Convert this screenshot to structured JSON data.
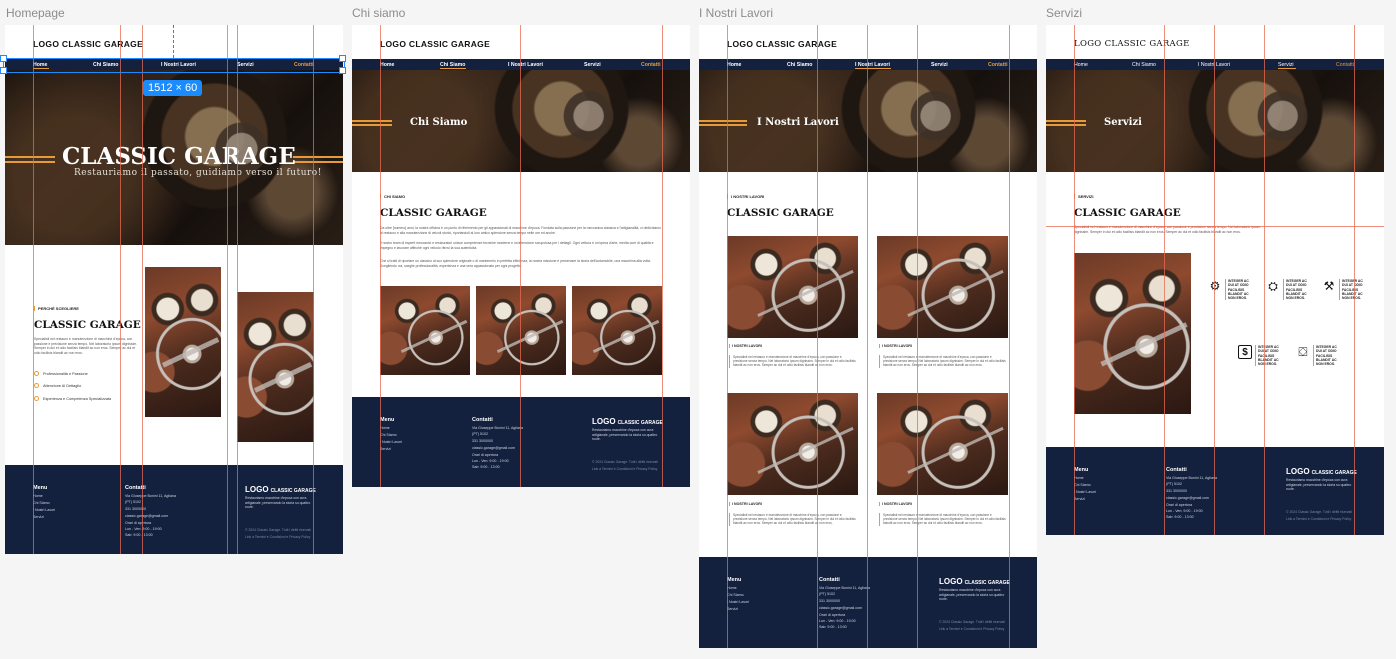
{
  "frames": {
    "homepage": {
      "label": "Homepage"
    },
    "chi_siamo": {
      "label": "Chi siamo"
    },
    "nostri_lavori": {
      "label": "I Nostri Lavori"
    },
    "servizi": {
      "label": "Servizi"
    }
  },
  "logo": "LOGO  CLASSIC GARAGE",
  "nav": {
    "home": "Home",
    "chi_siamo": "Chi Siamo",
    "lavori": "I Nostri Lavori",
    "servizi": "Servizi",
    "contatti": "Contatti"
  },
  "selection": {
    "dimensions": "1512 × 60"
  },
  "home": {
    "hero_title": "CLASSIC GARAGE",
    "hero_subtitle": "Restauriamo il passato, guidiamo verso il futuro!",
    "kicker": "PERCHÉ SCEGLIERE",
    "title": "CLASSIC GARAGE",
    "paragraph": "Specialisti nel restauro e manutenzione di macchine d'epoca, con passione e precisione senza tempo. Nel laboratorio ipsum dignissim. Semper in dui et odio facilisis blandit ac non eros. Semper ac dui et odio facilisis blandit ac non eros.",
    "bullets": [
      "Professionalità e Passione",
      "Attenzione Al Dettaglio",
      "Esperienza e Competenza Specializzata"
    ]
  },
  "chi": {
    "hero_title": "Chi Siamo",
    "kicker": "CHI SIAMO",
    "title": "CLASSIC GARAGE",
    "p1": "Da oltre [numero] anni, la nostra officina è un punto di riferimento per gli appassionati di macchine d'epoca. Fondata sulla passione per la meccanica classica e l'artigianalità, ci dedichiamo al restauro e alla manutenzione di veicoli storici, riportandoli al loro antico splendore senza tempo nelle ore ed anche.",
    "p2": "Il nostro team di esperti meccanici e restauratori unisce competenze tecniche moderne e un'attenzione scrupolosa per i dettagli. Ogni vettura è un'opera d'arte, merita cure di qualità e impegno e lavorare affinché ogni veicolo ritrovi la sua autenticità.",
    "p3": "Che si tratti di riportare un classico al suo splendore originale o di mantenerlo in perfetta efficienza, la nostra missione è preservare la storia dell'automobile, una macchina alla volta. Scegliendo noi, sceglie professionalità, esperienza e una vera appassionato per ogni progetto."
  },
  "lavori": {
    "hero_title": "I Nostri Lavori",
    "kicker": "I NOSTRI LAVORI",
    "title": "CLASSIC GARAGE",
    "card_caption": "I NOSTRI LAVORI",
    "card_text": "Specialisti nel restauro e manutenzione di macchine d'epoca, con passione e precisione senza tempo. Nel laboratorio ipsum dignissim. Semper in dui et odio facilisis blandit ac non eros. Semper ac dui et odio facilisis blandit ac non eros."
  },
  "servizi": {
    "hero_title": "Servizi",
    "kicker": "SERVIZI",
    "title": "CLASSIC GARAGE",
    "paragraph": "Specialisti nel restauro e manutenzione di macchine d'epoca, con passione e precisione senza tempo. Nel laboratorio ipsum dignissim. Semper in dui et odio facilisis blandit ac non eros. Semper ac dui et odio facilisis blandit ac non eros.",
    "service_text": "INTEGER AC DUI AT ODIO FACILISIS BLANDIT AC NON EROS.",
    "icons": [
      "mechanic-icon",
      "gear-icon",
      "tools-icon",
      "money-icon",
      "car-icon"
    ]
  },
  "footer": {
    "menu_head": "Menu",
    "menu_items": [
      "Home",
      "Chi Siamo",
      "I Nostri Lavori",
      "Servizi"
    ],
    "contact_head": "Contatti",
    "address": "Via Giuseppe Bonini 11, Agliana (PT) 5102",
    "phone": "331 3000000",
    "email": "classic.garage@gmail.com",
    "hours_head": "Orari di apertura",
    "hours_weekday": "Lun - Ven: 9:00 - 19:00",
    "hours_sat": "Sab: 9:00 - 13:00",
    "logo_main": "LOGO",
    "logo_sub": "CLASSIC GARAGE",
    "tagline": "Restauriamo macchine d'epoca con cura artigianale, preservando la storia su quattro ruote.",
    "copyright": "© 2024 Classic Garage. Tutti i diritti riservati",
    "legal": "Link a Termini e Condizioni e Privacy Policy"
  },
  "colors": {
    "navy": "#13213f",
    "accent": "#e69a3a",
    "guide": "#e86a53",
    "selection": "#1a8cff"
  }
}
